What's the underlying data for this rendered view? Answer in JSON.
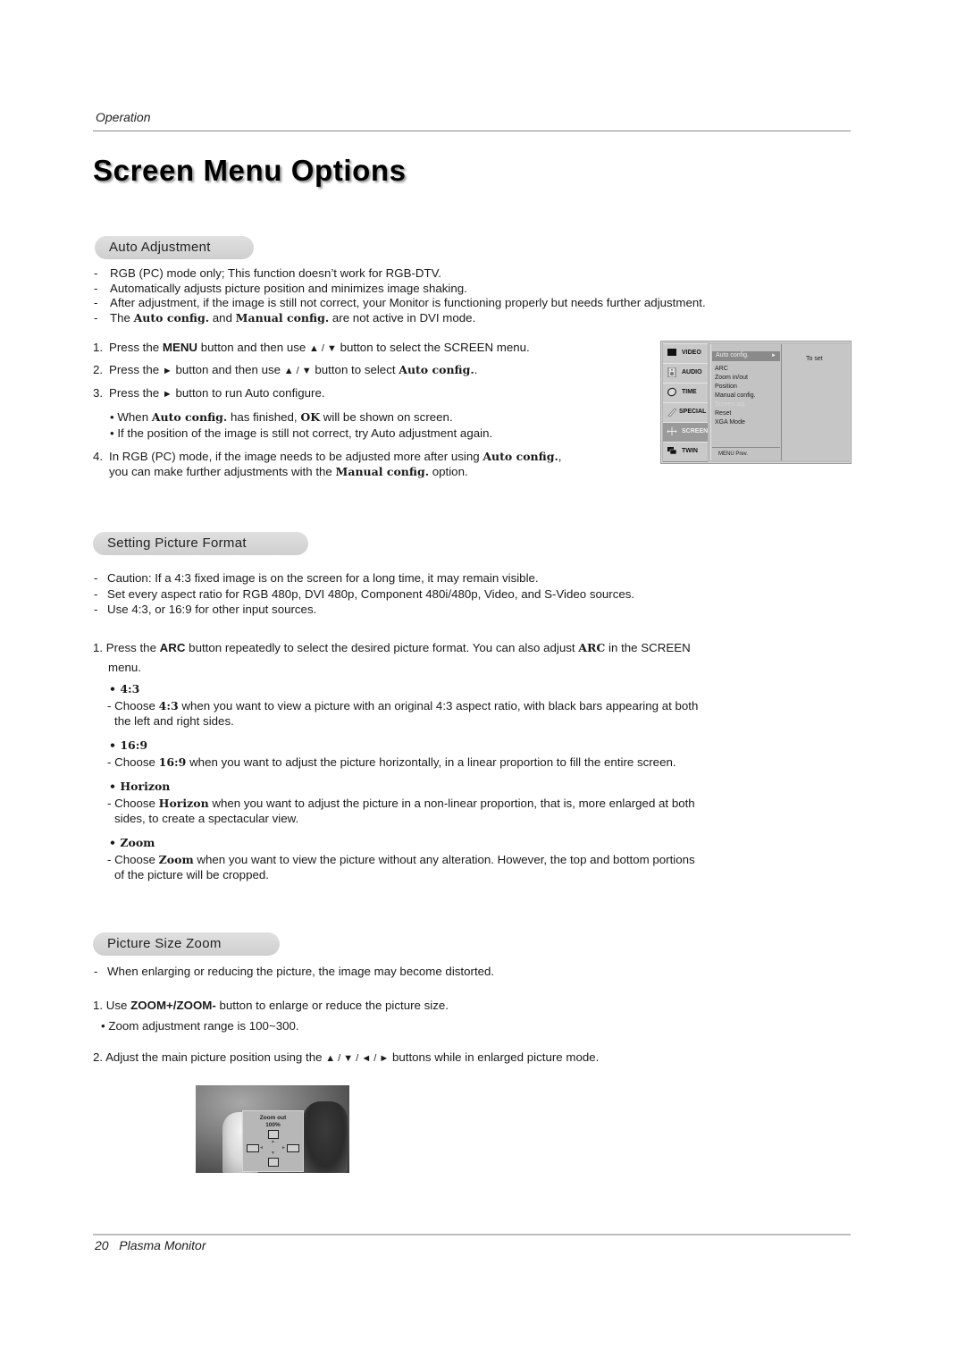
{
  "header": {
    "running_head": "Operation",
    "title": "Screen Menu Options"
  },
  "auto_adjustment": {
    "heading": "Auto Adjustment",
    "notes": [
      "RGB (PC) mode only; This function doesn’t work for RGB-DTV.",
      "Automatically adjusts picture position and minimizes image shaking.",
      "After adjustment, if the image is still not correct, your Monitor is functioning properly but needs further adjustment."
    ],
    "note4": {
      "pre": "The ",
      "b1": "Auto config.",
      "mid": " and ",
      "b2": "Manual config.",
      "post": " are not active in DVI mode."
    },
    "steps": {
      "s1": {
        "num": "1.",
        "pre": "Press the ",
        "key": "MENU",
        "mid": " button and then use ",
        "arrows": "▲ / ▼",
        "post": "  button to select the SCREEN menu."
      },
      "s2": {
        "num": "2.",
        "pre": "Press the ",
        "arrow": "►",
        "mid": " button and then use ",
        "arrows": "▲ / ▼",
        "post": "  button to select ",
        "b": "Auto config.",
        "end": "."
      },
      "s3": {
        "num": "3.",
        "pre": "Press the ",
        "arrow": "►",
        "post": " button to run Auto configure."
      },
      "b1": {
        "pre": "• When ",
        "b": "Auto config.",
        "mid": " has finished, ",
        "b2": "OK",
        "post": " will be shown on screen."
      },
      "b2": {
        "text": "• If the position of the image is still not correct, try Auto adjustment again."
      },
      "s4": {
        "num": "4.",
        "pre": "In RGB (PC) mode, if the image needs to be adjusted more after using ",
        "b": "Auto config.",
        "post": ",",
        "line2_pre": "you can make further adjustments with the ",
        "b2": "Manual config.",
        "line2_post": " option."
      }
    },
    "osd_menu": {
      "tabs": [
        {
          "label": "VIDEO",
          "icon": "video-icon"
        },
        {
          "label": "AUDIO",
          "icon": "audio-icon"
        },
        {
          "label": "TIME",
          "icon": "time-icon"
        },
        {
          "label": "SPECIAL",
          "icon": "special-icon"
        },
        {
          "label": "SCREEN",
          "icon": "screen-icon",
          "active": true
        },
        {
          "label": "TWIN",
          "icon": "twin-icon"
        }
      ],
      "selected_item": "Auto config.",
      "selected_arrow": "►",
      "items": [
        "ARC",
        "Zoom in/out",
        "Position",
        "Manual config.",
        "Screen adj.",
        "Reset",
        "XGA Mode"
      ],
      "footer": "MENU  Prev.",
      "hint": "To set"
    }
  },
  "picture_format": {
    "heading": "Setting Picture Format",
    "notes": [
      "Caution: If a 4:3 fixed image is on the screen for a long time, it may remain visible.",
      "Set every aspect ratio for RGB 480p, DVI 480p, Component 480i/480p, Video, and S-Video sources.",
      "Use 4:3, or 16:9 for other input sources."
    ],
    "step1": {
      "num": "1.",
      "pre": "Press the ",
      "key": "ARC",
      "mid": " button repeatedly to select the desired picture format. You can also adjust ",
      "b": "ARC",
      "post": " in the SCREEN",
      "line2": "menu."
    },
    "options": [
      {
        "name": "4:3",
        "pre": "- Choose ",
        "post": " when you want to view a picture with an original 4:3 aspect ratio, with black bars appearing at both",
        "line2": "the left and right sides."
      },
      {
        "name": "16:9",
        "pre": "- Choose ",
        "post": " when you want to adjust the picture horizontally, in a linear proportion to fill the entire screen.",
        "line2": ""
      },
      {
        "name": "Horizon",
        "pre": "- Choose ",
        "post": " when you want to adjust the picture in a non-linear proportion, that is, more enlarged at both",
        "line2": "sides, to create a spectacular view."
      },
      {
        "name": "Zoom",
        "pre": "- Choose ",
        "post": " when you want to view the picture without any alteration. However, the top and bottom portions",
        "line2": "of the picture will be cropped."
      }
    ],
    "bullet": "•"
  },
  "picture_zoom": {
    "heading": "Picture Size Zoom",
    "note": "When enlarging or reducing the picture, the image may become distorted.",
    "step1": {
      "num": "1.",
      "pre": "Use ",
      "key": "ZOOM+/ZOOM-",
      "post": " button to enlarge or reduce the picture size."
    },
    "bullet": "• Zoom adjustment range is 100~300.",
    "step2": {
      "num": "2.",
      "pre": "Adjust the main picture position using the ",
      "arrows": "▲ / ▼ / ◄ / ►",
      "post": " buttons while in enlarged picture mode."
    },
    "osd": {
      "label": "Zoom out",
      "value": "100%"
    }
  },
  "footer": {
    "page": "20",
    "title": "Plasma Monitor"
  },
  "dash": "-"
}
